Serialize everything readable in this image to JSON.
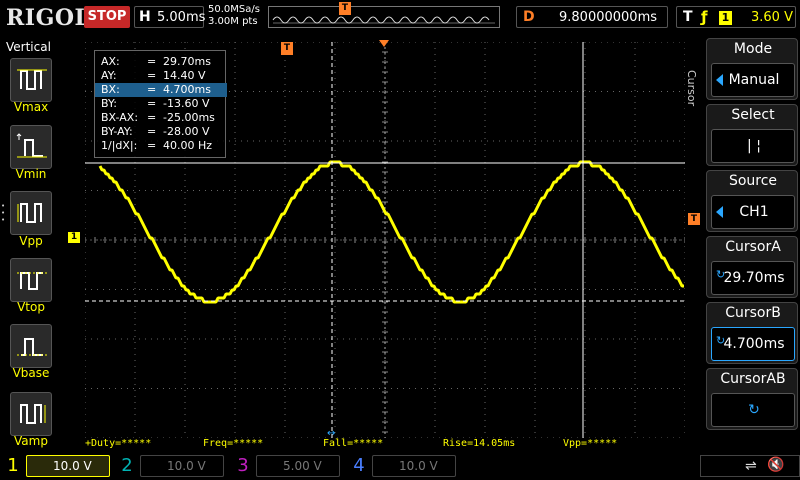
{
  "top": {
    "logo": "RIGOL",
    "run_state": "STOP",
    "timebase_letter": "H",
    "timebase_value": "5.00ms",
    "sample_rate": "50.0MSa/s",
    "memory_depth": "3.00M pts",
    "trigger_pos_marker": "T",
    "delay_letter": "D",
    "delay_value": "9.80000000ms",
    "trigger_letter": "T",
    "trigger_edge": "ƒ",
    "trigger_source": "1",
    "trigger_level": "3.60 V"
  },
  "left": {
    "title": "Vertical",
    "buttons": [
      {
        "label": "Vmax",
        "icon": "vmax-icon"
      },
      {
        "label": "Vmin",
        "icon": "vmin-icon"
      },
      {
        "label": "Vpp",
        "icon": "vpp-icon"
      },
      {
        "label": "Vtop",
        "icon": "vtop-icon"
      },
      {
        "label": "Vbase",
        "icon": "vbase-icon"
      },
      {
        "label": "Vamp",
        "icon": "vamp-icon"
      }
    ]
  },
  "cursor_readout": {
    "rows": [
      {
        "k": "AX:",
        "eq": "=",
        "v": "29.70ms"
      },
      {
        "k": "AY:",
        "eq": "=",
        "v": "14.40 V"
      },
      {
        "k": "BX:",
        "eq": "=",
        "v": "4.700ms"
      },
      {
        "k": "BY:",
        "eq": "=",
        "v": "-13.60 V"
      },
      {
        "k": "BX-AX:",
        "eq": "=",
        "v": "-25.00ms"
      },
      {
        "k": "BY-AY:",
        "eq": "=",
        "v": "-28.00 V"
      },
      {
        "k": "1/|dX|:",
        "eq": "=",
        "v": "40.00 Hz"
      }
    ]
  },
  "markers": {
    "ch1": "1",
    "trigger_T": "T",
    "trigger_level": "T"
  },
  "measurements": {
    "duty": "+Duty=*****",
    "freq": "Freq=*****",
    "fall": "Fall=*****",
    "rise": "Rise=14.05ms",
    "vpp": "Vpp=*****"
  },
  "channels": [
    {
      "num": "1",
      "scale": "10.0 V"
    },
    {
      "num": "2",
      "scale": "10.0 V"
    },
    {
      "num": "3",
      "scale": "5.00 V"
    },
    {
      "num": "4",
      "scale": "10.0 V"
    }
  ],
  "menu": {
    "vertical_title": "Cursor",
    "items": [
      {
        "title": "Mode",
        "value": "Manual"
      },
      {
        "title": "Select",
        "value": "|   ¦"
      },
      {
        "title": "Source",
        "value": "CH1"
      },
      {
        "title": "CursorA",
        "value": "29.70ms"
      },
      {
        "title": "CursorB",
        "value": "4.700ms"
      },
      {
        "title": "CursorAB",
        "value": "↻"
      }
    ]
  },
  "colors": {
    "trace": "#ffff00",
    "trigger": "#ff7f27",
    "highlight": "#1e5f8e",
    "accent": "#2aa7ff"
  }
}
